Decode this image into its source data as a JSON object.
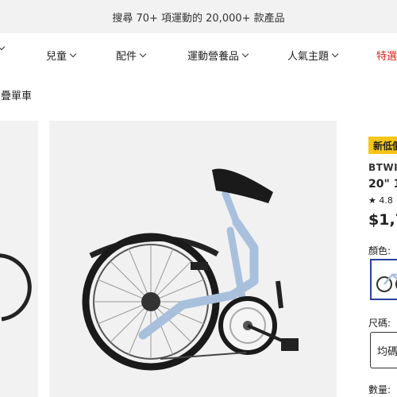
{
  "banner": {
    "text": "搜尋 70+ 項運動的 20,000+ 款產品"
  },
  "nav": {
    "items": [
      {
        "label": ""
      },
      {
        "label": "兒童"
      },
      {
        "label": "配件"
      },
      {
        "label": "運動營養品"
      },
      {
        "label": "人氣主題"
      },
      {
        "label": "特選"
      }
    ]
  },
  "breadcrumb": {
    "text": "摺疊單車"
  },
  "product": {
    "badge": "新低價",
    "brand": "BTWIN",
    "title": "20\" 1",
    "rating": "★ 4.8",
    "price": "$1,7",
    "color_label": "顏色:",
    "size_label": "尺碼:",
    "size_value": "均碼",
    "qty_label": "數量:"
  },
  "colors": {
    "accent_red": "#e0221c",
    "badge_yellow": "#f5c518",
    "selected_border": "#2a3f9d",
    "bike_frame": "#a9c0dd"
  }
}
